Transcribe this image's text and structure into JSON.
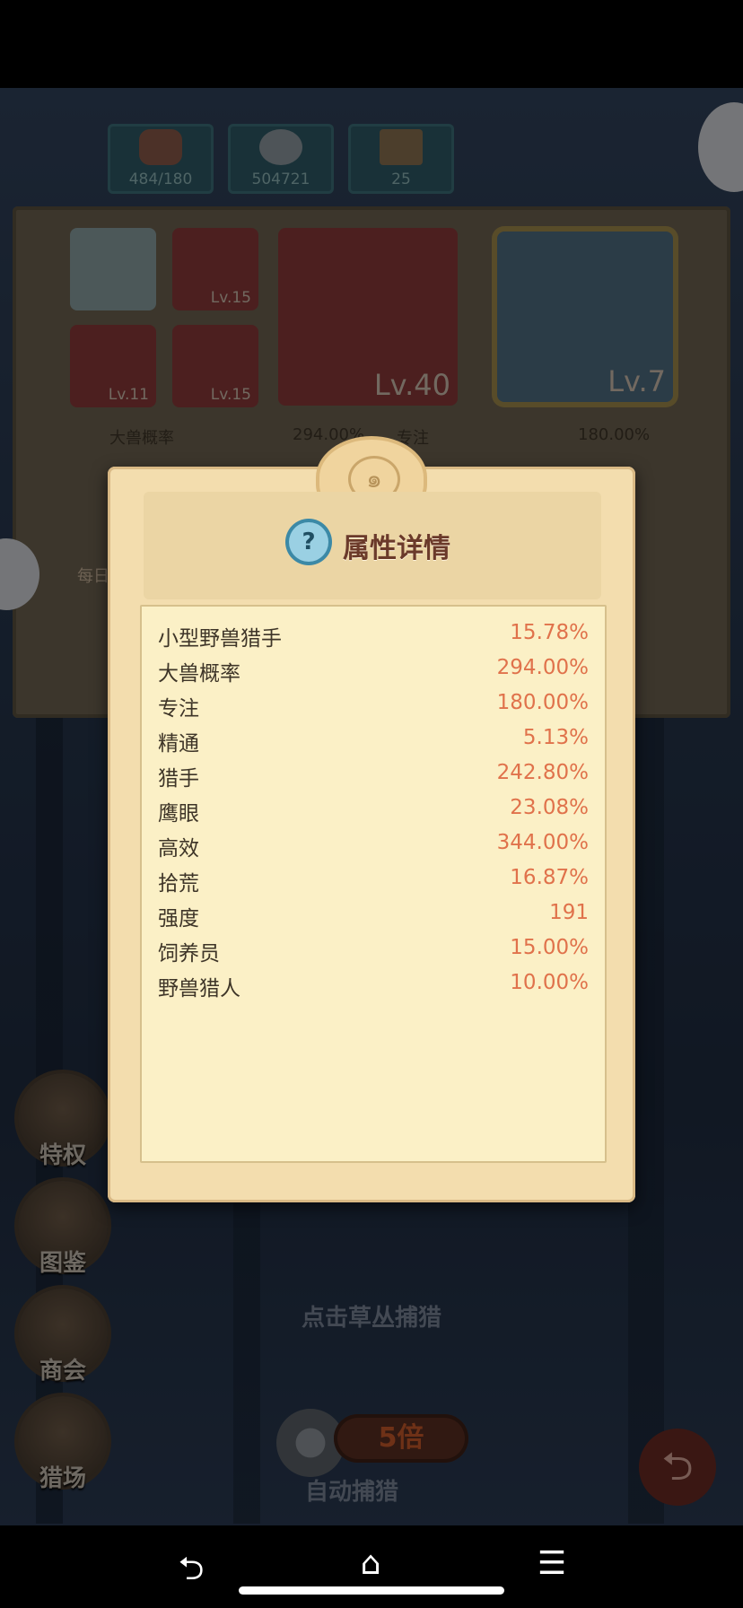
{
  "resources": [
    {
      "value": "484/180"
    },
    {
      "value": "504721"
    },
    {
      "value": "25"
    }
  ],
  "equipment": {
    "slots": [
      {
        "level": "Lv.15"
      },
      {
        "level": "Lv.11"
      },
      {
        "level": "Lv.15"
      },
      {
        "level": "Lv.40"
      },
      {
        "level": "Lv.7"
      }
    ]
  },
  "background_stats": {
    "row1_left_label": "大兽概率",
    "row1_left_value": "294.00%",
    "row1_right_label": "专注",
    "row1_right_value": "180.00%",
    "daily_label": "每日"
  },
  "side_menu": {
    "privilege": "特权",
    "codex": "图鉴",
    "guild": "商会",
    "hunting_ground": "猎场"
  },
  "hint": "点击草丛捕猎",
  "auto_hunt": {
    "multiplier": "5倍",
    "label": "自动捕猎"
  },
  "modal": {
    "title": "属性详情",
    "help_glyph": "?",
    "attributes": [
      {
        "name": "小型野兽猎手",
        "value": "15.78%"
      },
      {
        "name": "大兽概率",
        "value": "294.00%"
      },
      {
        "name": "专注",
        "value": "180.00%"
      },
      {
        "name": "精通",
        "value": "5.13%"
      },
      {
        "name": "猎手",
        "value": "242.80%"
      },
      {
        "name": "鹰眼",
        "value": "23.08%"
      },
      {
        "name": "高效",
        "value": "344.00%"
      },
      {
        "name": "拾荒",
        "value": "16.87%"
      },
      {
        "name": "强度",
        "value": "191"
      },
      {
        "name": "饲养员",
        "value": "15.00%"
      },
      {
        "name": "野兽猎人",
        "value": "10.00%"
      }
    ]
  },
  "nav": {
    "back": "⮌",
    "home": "⌂",
    "menu": "☰"
  },
  "colors": {
    "modal_bg": "#f3ddae",
    "list_bg": "#fbf0c6",
    "value_text": "#e0724b",
    "label_text": "#3e3528",
    "title_text": "#6b3a2a"
  }
}
